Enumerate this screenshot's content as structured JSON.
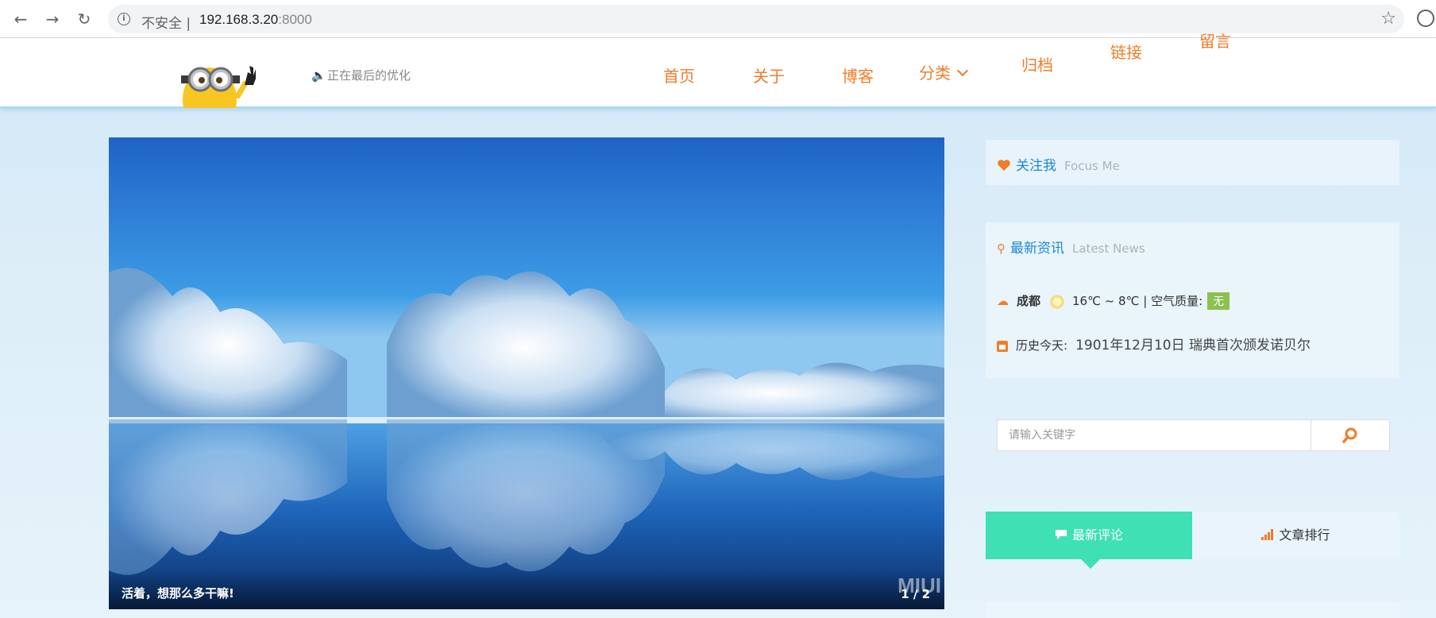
{
  "browser": {
    "security_label": "不安全",
    "separator": "|",
    "url_host": "192.168.3.20",
    "url_port": ":8000"
  },
  "header": {
    "notice": "正在最后的优化",
    "nav": [
      "首页",
      "关于",
      "博客",
      "分类",
      "归档",
      "链接",
      "留言"
    ]
  },
  "slider": {
    "caption": "活着，想那么多干嘛!",
    "counter": "1 / 2",
    "watermark": "MIUI"
  },
  "focus_panel": {
    "title": "关注我",
    "title_en": "Focus Me"
  },
  "news_panel": {
    "title": "最新资讯",
    "title_en": "Latest News",
    "city": "成都",
    "temperature": "16℃ ~ 8℃",
    "sep": "|",
    "air_quality_label": "空气质量:",
    "air_quality_value": "无",
    "history_label": "历史今天:",
    "history_event": "1901年12月10日 瑞典首次颁发诺贝尔"
  },
  "search": {
    "placeholder": "请输入关键字"
  },
  "tabs": {
    "active": "最新评论",
    "inactive": "文章排行"
  },
  "colors": {
    "accent_orange": "#ef7d2a",
    "title_blue": "#1e88d6",
    "tab_green": "#3ee0b4",
    "badge_green": "#8cc152"
  }
}
